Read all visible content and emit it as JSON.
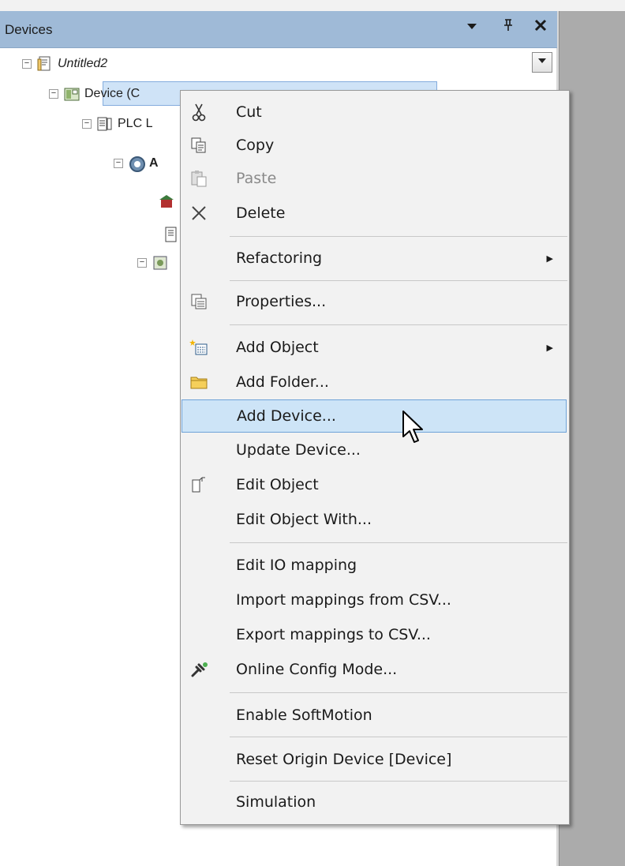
{
  "panel": {
    "title": "Devices",
    "dropdown_glyph": "▾",
    "pin_glyph": "ᅮ",
    "close_glyph": "✕"
  },
  "tree": {
    "root": "Untitled2",
    "device": "Device (C",
    "plc": "PLC L",
    "app_initial": "A"
  },
  "menu": {
    "items": [
      {
        "label": "Cut",
        "icon": "scissors-icon"
      },
      {
        "label": "Copy",
        "icon": "copy-icon"
      },
      {
        "label": "Paste",
        "icon": "paste-icon",
        "disabled": true
      },
      {
        "label": "Delete",
        "icon": "delete-icon"
      },
      {
        "label": "Refactoring",
        "submenu": true
      },
      {
        "label": "Properties...",
        "icon": "properties-icon"
      },
      {
        "label": "Add Object",
        "icon": "add-object-icon",
        "submenu": true
      },
      {
        "label": "Add Folder...",
        "icon": "folder-icon"
      },
      {
        "label": "Add Device...",
        "hovered": true
      },
      {
        "label": "Update Device..."
      },
      {
        "label": "Edit Object",
        "icon": "edit-object-icon"
      },
      {
        "label": "Edit Object With..."
      },
      {
        "label": "Edit IO mapping"
      },
      {
        "label": "Import mappings from CSV..."
      },
      {
        "label": "Export mappings to CSV..."
      },
      {
        "label": "Online Config Mode...",
        "icon": "wrench-icon"
      },
      {
        "label": "Enable SoftMotion"
      },
      {
        "label": "Reset Origin Device [Device]"
      },
      {
        "label": "Simulation"
      }
    ],
    "submenu_arrow": "▶"
  },
  "colors": {
    "header": "#9fbad7",
    "selection": "#cde4f7",
    "menu_bg": "#f2f2f2",
    "workspace": "#ababab"
  }
}
